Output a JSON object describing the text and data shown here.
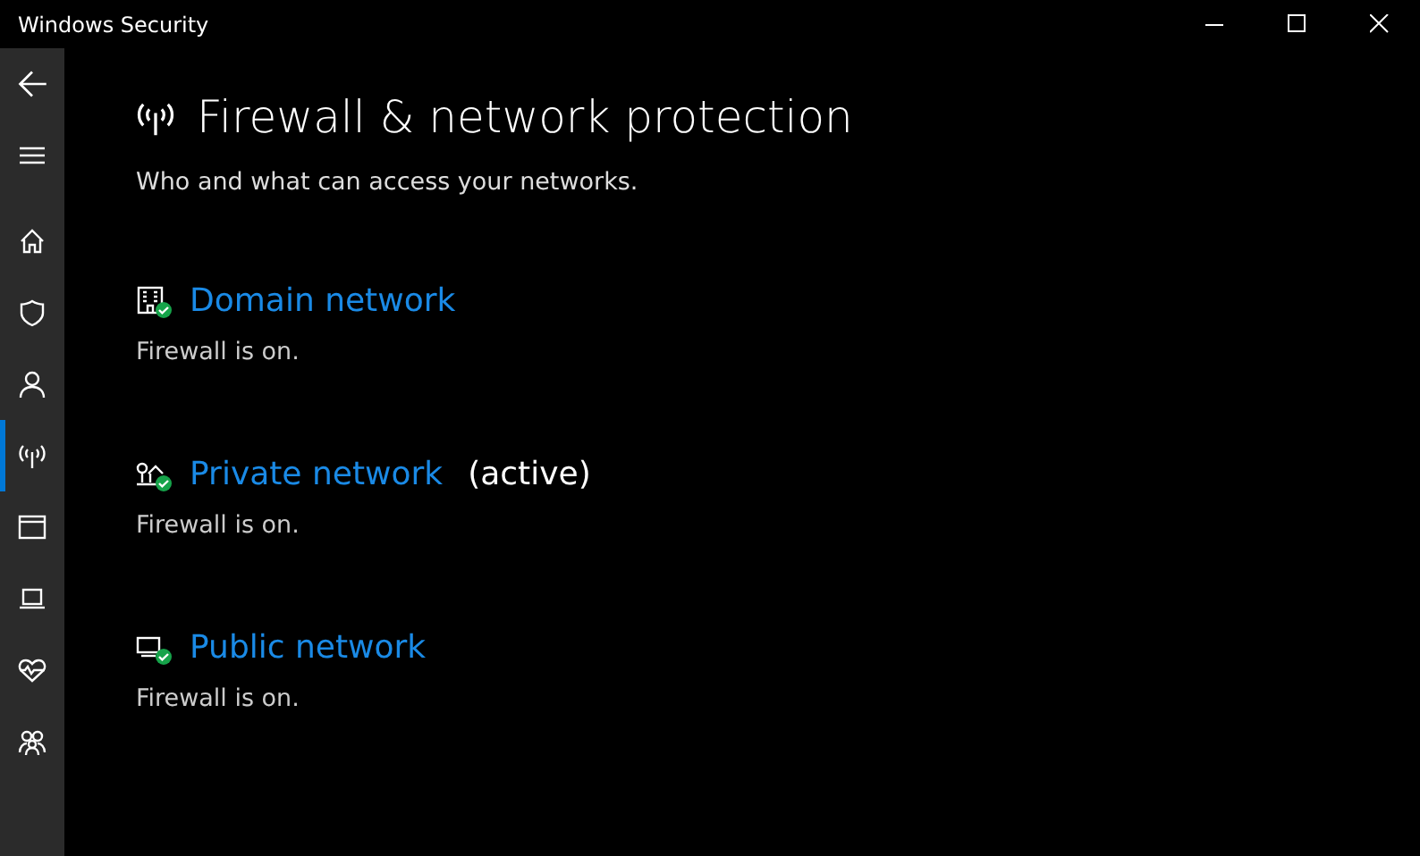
{
  "window": {
    "title": "Windows Security"
  },
  "sidebar": {
    "items": [
      {
        "selected": false
      },
      {
        "selected": false
      },
      {
        "selected": false
      },
      {
        "selected": false
      },
      {
        "selected": false
      },
      {
        "selected": true
      },
      {
        "selected": false
      },
      {
        "selected": false
      },
      {
        "selected": false
      },
      {
        "selected": false
      }
    ]
  },
  "page": {
    "title": "Firewall & network protection",
    "subtitle": "Who and what can access your networks."
  },
  "networks": [
    {
      "name": "Domain network",
      "status": "Firewall is on.",
      "firewall_on": true
    },
    {
      "name": "Private network",
      "note": "(active)",
      "status": "Firewall is on.",
      "firewall_on": true
    },
    {
      "name": "Public network",
      "status": "Firewall is on.",
      "firewall_on": true
    }
  ]
}
